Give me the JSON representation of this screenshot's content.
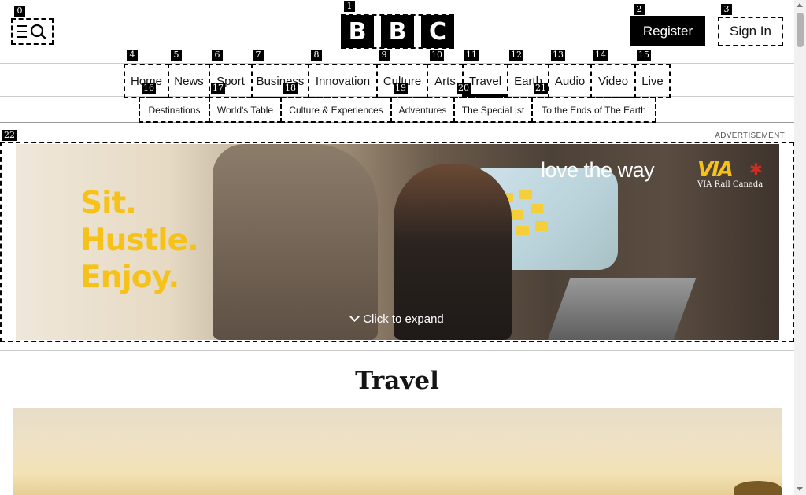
{
  "header": {
    "logo_letters": [
      "B",
      "B",
      "C"
    ],
    "register_label": "Register",
    "signin_label": "Sign In"
  },
  "main_nav": [
    "Home",
    "News",
    "Sport",
    "Business",
    "Innovation",
    "Culture",
    "Arts",
    "Travel",
    "Earth",
    "Audio",
    "Video",
    "Live"
  ],
  "sub_nav": [
    "Destinations",
    "World's Table",
    "Culture & Experiences",
    "Adventures",
    "The SpeciaList",
    "To the Ends of The Earth"
  ],
  "ad": {
    "label": "ADVERTISEMENT",
    "tagline": [
      "Sit.",
      "Hustle.",
      "Enjoy."
    ],
    "slogan": "love the way",
    "brand_logo": "VIA",
    "brand_name": "VIA Rail Canada",
    "expand_label": "Click to expand"
  },
  "page": {
    "title": "Travel"
  },
  "badges": [
    "0",
    "1",
    "2",
    "3",
    "4",
    "5",
    "6",
    "7",
    "8",
    "9",
    "10",
    "11",
    "12",
    "13",
    "14",
    "15",
    "16",
    "17",
    "18",
    "19",
    "20",
    "21",
    "22"
  ],
  "colors": {
    "accent": "#000000",
    "ad_yellow": "#f6c21a",
    "via_red": "#d52b1e"
  },
  "icons": {
    "menu": "menu-search-icon",
    "expand": "chevron-down-icon",
    "leaf": "maple-leaf-icon"
  }
}
